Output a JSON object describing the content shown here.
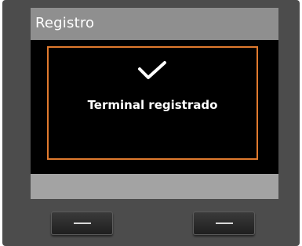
{
  "screen": {
    "title": "Registro"
  },
  "dialog": {
    "icon": "check-icon",
    "message": "Terminal registrado",
    "border_color": "#e07a2e"
  },
  "hardware_keys": {
    "left": {
      "icon": "minus-bar-icon"
    },
    "right": {
      "icon": "minus-bar-icon"
    }
  }
}
